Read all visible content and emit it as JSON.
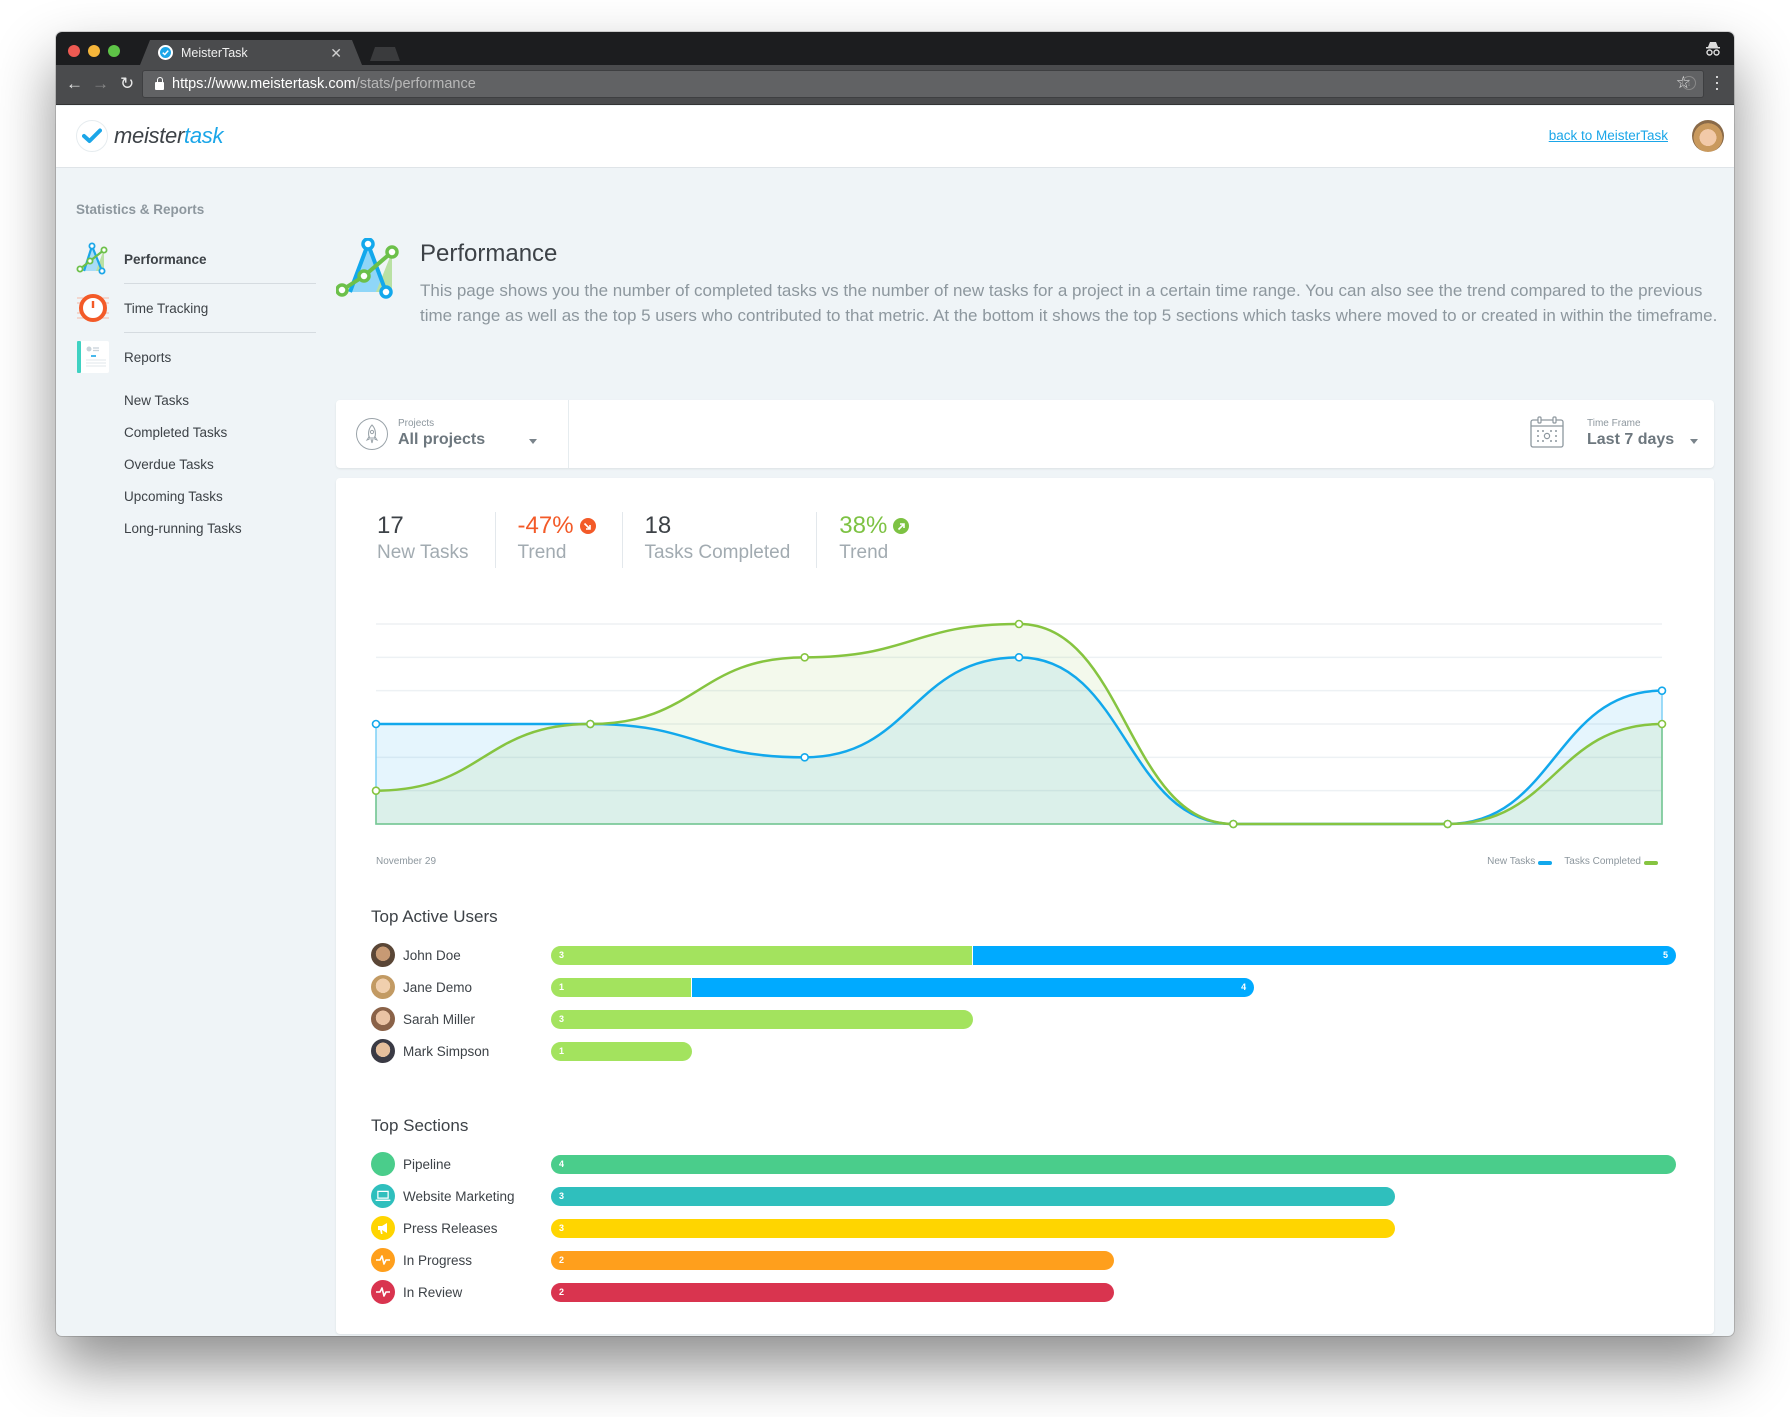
{
  "browser": {
    "tab_title": "MeisterTask",
    "url_main": "https://www.meistertask.com",
    "url_path": "/stats/performance"
  },
  "header": {
    "logo_part1": "meister",
    "logo_part2": "task",
    "back_link": "back to MeisterTask"
  },
  "sidebar": {
    "heading": "Statistics & Reports",
    "items": [
      {
        "label": "Performance",
        "icon": "performance-chart-icon",
        "active": true
      },
      {
        "label": "Time Tracking",
        "icon": "stopwatch-icon",
        "active": false
      },
      {
        "label": "Reports",
        "icon": "report-document-icon",
        "active": false
      }
    ],
    "sub_items": [
      "New Tasks",
      "Completed Tasks",
      "Overdue Tasks",
      "Upcoming Tasks",
      "Long-running Tasks"
    ]
  },
  "page": {
    "title": "Performance",
    "description": "This page shows you the number of completed tasks vs the number of new tasks for a project in a certain time range. You can also see the trend compared to the previous time range as well as the top 5 users who contributed to that metric. At the bottom it shows the top 5 sections which tasks where moved to or created in within the timeframe."
  },
  "filters": {
    "projects_label": "Projects",
    "projects_value": "All projects",
    "timeframe_label": "Time Frame",
    "timeframe_value": "Last 7 days"
  },
  "stats": {
    "new_tasks": "17",
    "new_tasks_label": "New Tasks",
    "new_trend": "-47%",
    "new_trend_label": "Trend",
    "completed": "18",
    "completed_label": "Tasks Completed",
    "completed_trend": "38%",
    "completed_trend_label": "Trend"
  },
  "chart_data": {
    "type": "area",
    "title": "",
    "x": [
      "November 29",
      "",
      "",
      "",
      "",
      "",
      ""
    ],
    "x_start_label": "November 29",
    "ylim": [
      0,
      6
    ],
    "grid": true,
    "legend_position": "bottom-right",
    "series": [
      {
        "name": "New Tasks",
        "color": "#12a8ec",
        "values": [
          3,
          3,
          2,
          5,
          0,
          0,
          4
        ]
      },
      {
        "name": "Tasks Completed",
        "color": "#86c440",
        "values": [
          1,
          3,
          5,
          6,
          0,
          0,
          3
        ]
      }
    ]
  },
  "top_users": {
    "title": "Top Active Users",
    "max": 8,
    "colors": {
      "completed": "#a3e35e",
      "new": "#00aaff"
    },
    "rows": [
      {
        "name": "John Doe",
        "completed": 3,
        "new": 5
      },
      {
        "name": "Jane Demo",
        "completed": 1,
        "new": 4
      },
      {
        "name": "Sarah Miller",
        "completed": 3,
        "new": 0
      },
      {
        "name": "Mark Simpson",
        "completed": 1,
        "new": 0
      }
    ]
  },
  "top_sections": {
    "title": "Top Sections",
    "max": 4,
    "rows": [
      {
        "name": "Pipeline",
        "value": 4,
        "color": "#4acd8b",
        "icon": "circle-icon"
      },
      {
        "name": "Website Marketing",
        "value": 3,
        "color": "#2fbfbd",
        "icon": "laptop-icon"
      },
      {
        "name": "Press Releases",
        "value": 3,
        "color": "#ffd500",
        "icon": "megaphone-icon"
      },
      {
        "name": "In Progress",
        "value": 2,
        "color": "#ff9f1c",
        "icon": "pulse-icon"
      },
      {
        "name": "In Review",
        "value": 2,
        "color": "#d9344f",
        "icon": "pulse-icon"
      }
    ]
  }
}
